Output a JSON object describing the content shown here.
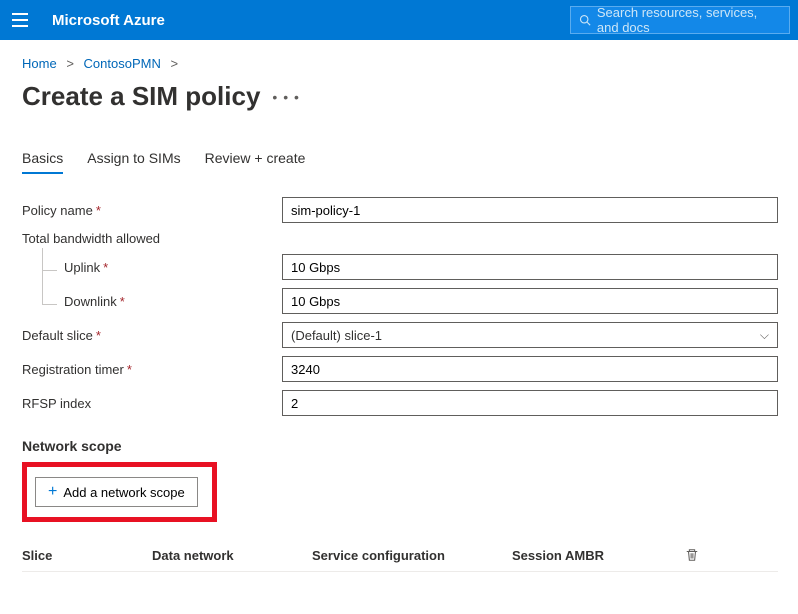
{
  "header": {
    "brand": "Microsoft Azure",
    "search_placeholder": "Search resources, services, and docs"
  },
  "breadcrumb": {
    "home": "Home",
    "parent": "ContosoPMN"
  },
  "page": {
    "title": "Create a SIM policy"
  },
  "tabs": {
    "basics": "Basics",
    "assign": "Assign to SIMs",
    "review": "Review + create"
  },
  "form": {
    "policy_name_label": "Policy name",
    "policy_name_value": "sim-policy-1",
    "total_bandwidth_label": "Total bandwidth allowed",
    "uplink_label": "Uplink",
    "uplink_value": "10 Gbps",
    "downlink_label": "Downlink",
    "downlink_value": "10 Gbps",
    "default_slice_label": "Default slice",
    "default_slice_value": "(Default) slice-1",
    "reg_timer_label": "Registration timer",
    "reg_timer_value": "3240",
    "rfsp_label": "RFSP index",
    "rfsp_value": "2"
  },
  "network_scope": {
    "section_title": "Network scope",
    "add_button_label": "Add a network scope",
    "columns": {
      "slice": "Slice",
      "data_network": "Data network",
      "service_config": "Service configuration",
      "session_ambr": "Session AMBR"
    }
  }
}
